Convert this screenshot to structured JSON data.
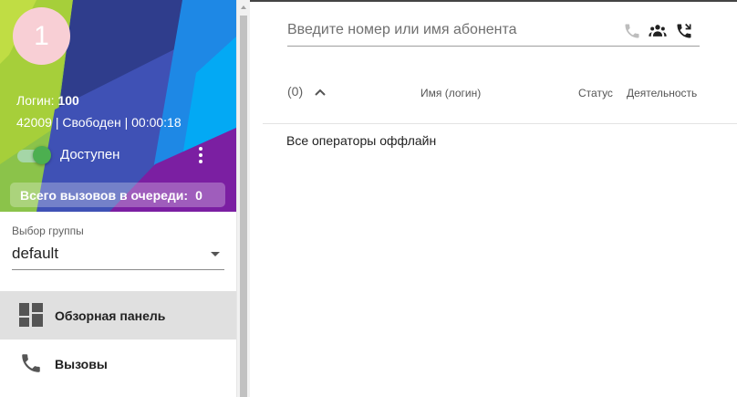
{
  "profile": {
    "avatar_text": "1",
    "login_label": "Логин:",
    "login_value": "100",
    "state_line": "42009 | Свободен | 00:00:18",
    "toggle_state": true,
    "availability": "Доступен",
    "queue_label": "Всего вызовов в очереди:",
    "queue_count": "0"
  },
  "group": {
    "label": "Выбор группы",
    "selected": "default"
  },
  "nav": {
    "items": [
      {
        "label": "Обзорная панель",
        "icon": "dashboard-icon",
        "active": true
      },
      {
        "label": "Вызовы",
        "icon": "phone-icon",
        "active": false
      }
    ]
  },
  "search": {
    "placeholder": "Введите номер или имя абонента",
    "value": "",
    "icons": [
      "phone-icon",
      "group-icon",
      "call-forward-icon"
    ]
  },
  "table": {
    "count": "(0)",
    "columns": [
      "Имя (логин)",
      "Статус",
      "Деятельность"
    ],
    "empty_text": "Все операторы оффлайн"
  },
  "colors": {
    "toggle_on": "#4caf50",
    "active_nav_bg": "#e0e0e0",
    "avatar_bg": "#f8cfd5"
  }
}
